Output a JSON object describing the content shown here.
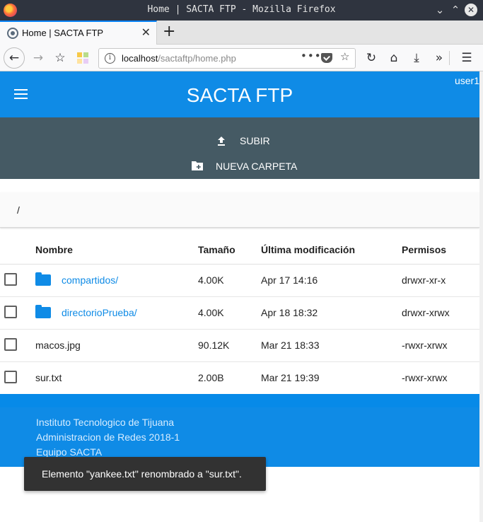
{
  "window": {
    "title": "Home | SACTA FTP - Mozilla Firefox"
  },
  "tab": {
    "label": "Home | SACTA FTP"
  },
  "urlbar": {
    "host": "localhost",
    "path": "/sactaftp/home.php"
  },
  "app": {
    "title": "SACTA FTP",
    "user": "user1"
  },
  "actions": {
    "upload": "SUBIR",
    "new_folder": "NUEVA CARPETA"
  },
  "current_path": "/",
  "table": {
    "headers": [
      "Nombre",
      "Tamaño",
      "Última modificación",
      "Permisos"
    ],
    "rows": [
      {
        "name": "compartidos/",
        "size": "4.00K",
        "modified": "Apr 17 14:16",
        "perms": "drwxr-xr-x",
        "is_folder": true
      },
      {
        "name": "directorioPrueba/",
        "size": "4.00K",
        "modified": "Apr 18 18:32",
        "perms": "drwxr-xrwx",
        "is_folder": true
      },
      {
        "name": "macos.jpg",
        "size": "90.12K",
        "modified": "Mar 21 18:33",
        "perms": "-rwxr-xrwx",
        "is_folder": false
      },
      {
        "name": "sur.txt",
        "size": "2.00B",
        "modified": "Mar 21 19:39",
        "perms": "-rwxr-xrwx",
        "is_folder": false
      }
    ]
  },
  "footer": {
    "line1": "Instituto Tecnologico de Tijuana",
    "line2": "Administracion de Redes 2018-1",
    "line3": "Equipo SACTA"
  },
  "toast": "Elemento \"yankee.txt\" renombrado a \"sur.txt\".",
  "colors": {
    "primary": "#0f8be6",
    "action_bar": "#455a64",
    "toast_bg": "#323232"
  }
}
